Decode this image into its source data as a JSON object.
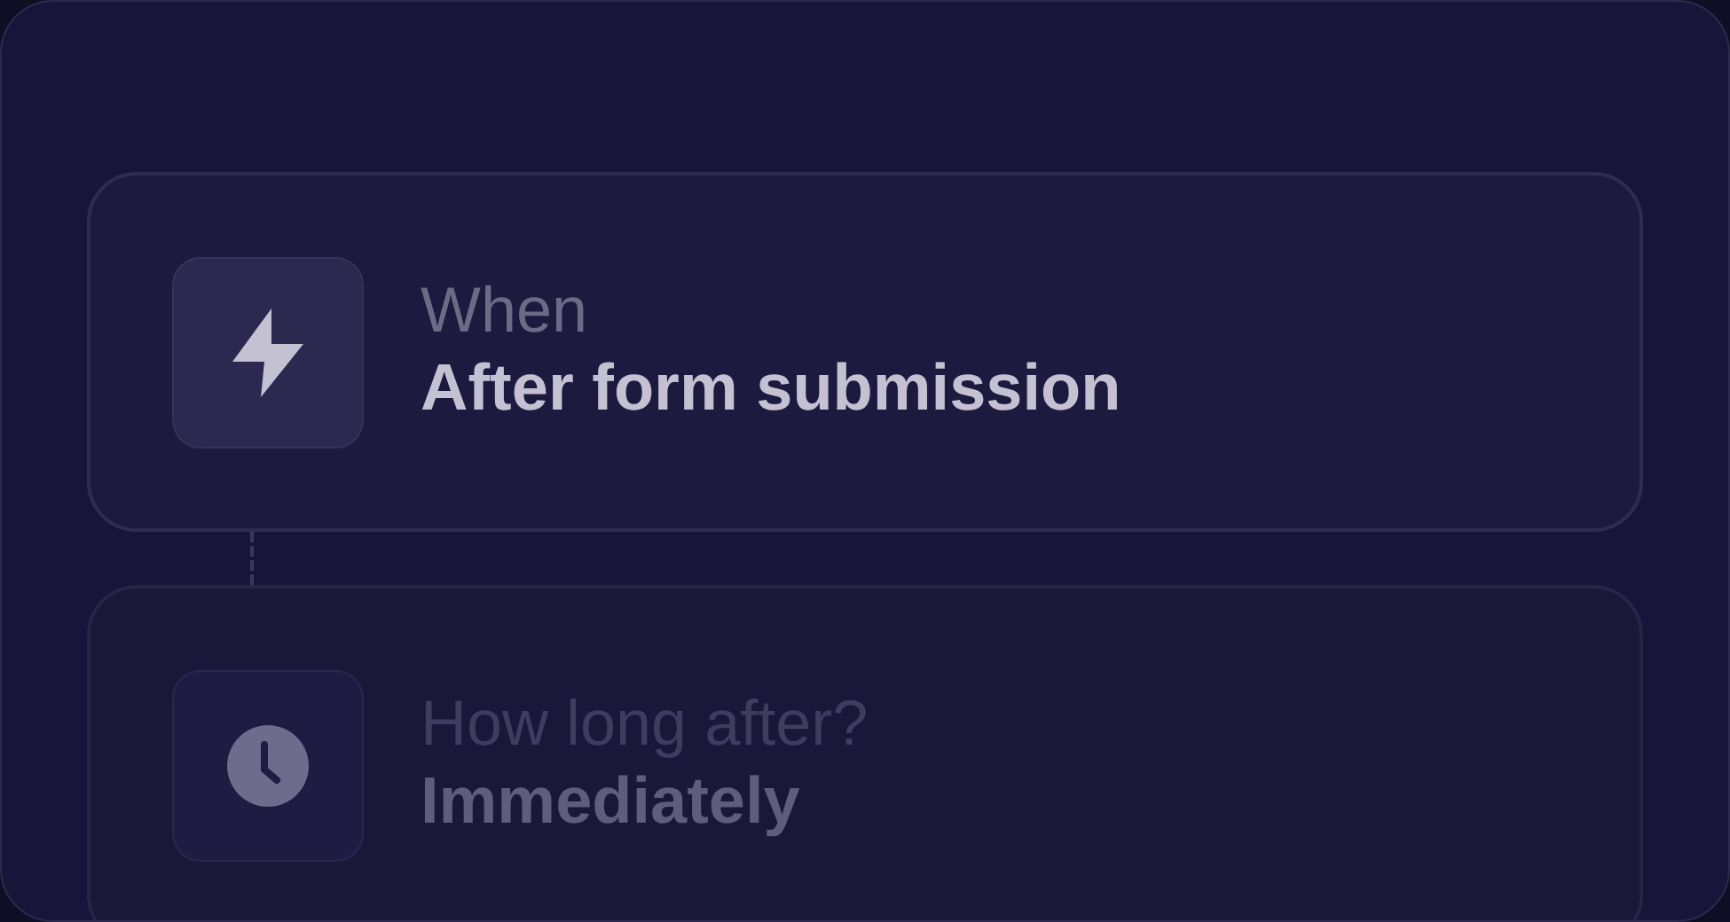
{
  "steps": [
    {
      "kind": "trigger",
      "label": "When",
      "value": "After form submission",
      "dimmed": false
    },
    {
      "kind": "delay",
      "label": "How long after?",
      "value": "Immediately",
      "dimmed": true
    }
  ]
}
